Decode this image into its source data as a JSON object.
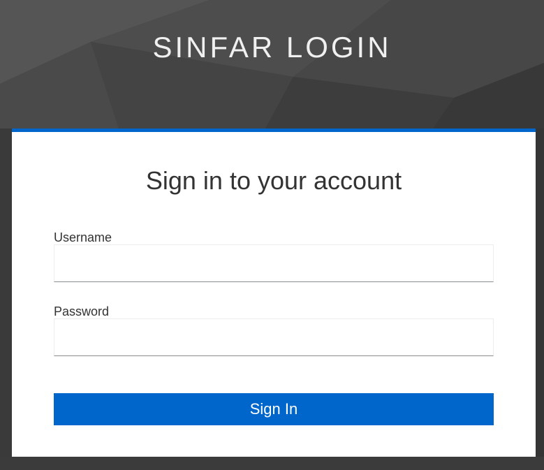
{
  "header": {
    "title": "SINFAR LOGIN"
  },
  "login_card": {
    "title": "Sign in to your account",
    "username_label": "Username",
    "username_value": "",
    "password_label": "Password",
    "password_value": "",
    "submit_label": "Sign In"
  },
  "colors": {
    "accent": "#0066cc",
    "background": "#3f3f3f",
    "card": "#ffffff"
  }
}
